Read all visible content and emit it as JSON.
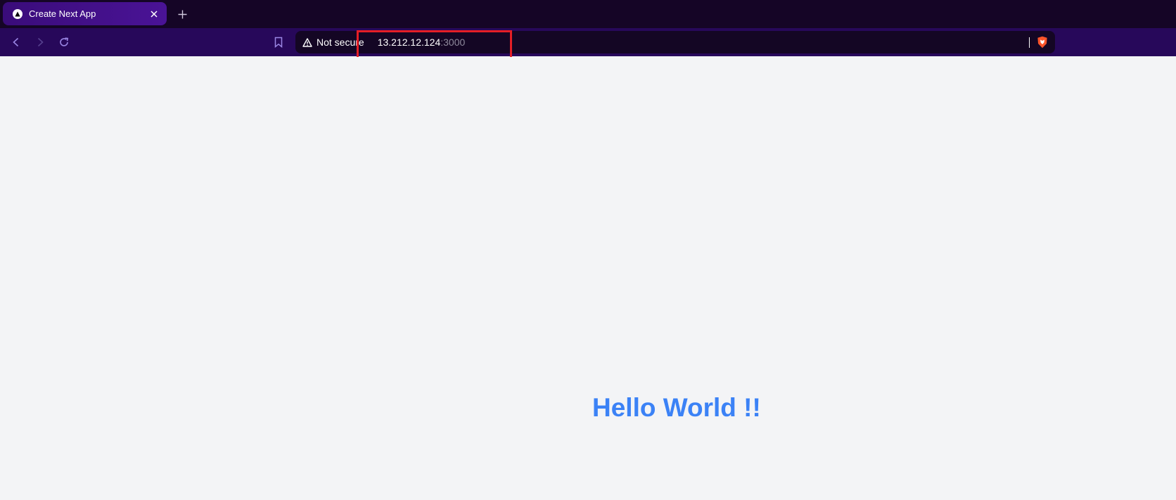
{
  "tab": {
    "title": "Create Next App",
    "favicon": "nextjs-triangle-icon"
  },
  "toolbar": {
    "back_icon": "chevron-left-icon",
    "forward_icon": "chevron-right-icon",
    "reload_icon": "reload-icon",
    "bookmark_icon": "bookmark-icon"
  },
  "address_bar": {
    "security_label": "Not secure",
    "security_icon": "warning-triangle-icon",
    "host": "13.212.12.124",
    "port": ":3000",
    "shield_icon": "brave-lion-icon"
  },
  "page": {
    "heading": "Hello World !!"
  },
  "colors": {
    "tabstrip": "#150526",
    "toolbar": "#27085a",
    "active_tab": "#4a1396",
    "omnibox": "#140624",
    "page_background": "#f3f4f6",
    "heading": "#3b82f6",
    "annotation_box": "#e41e26"
  }
}
